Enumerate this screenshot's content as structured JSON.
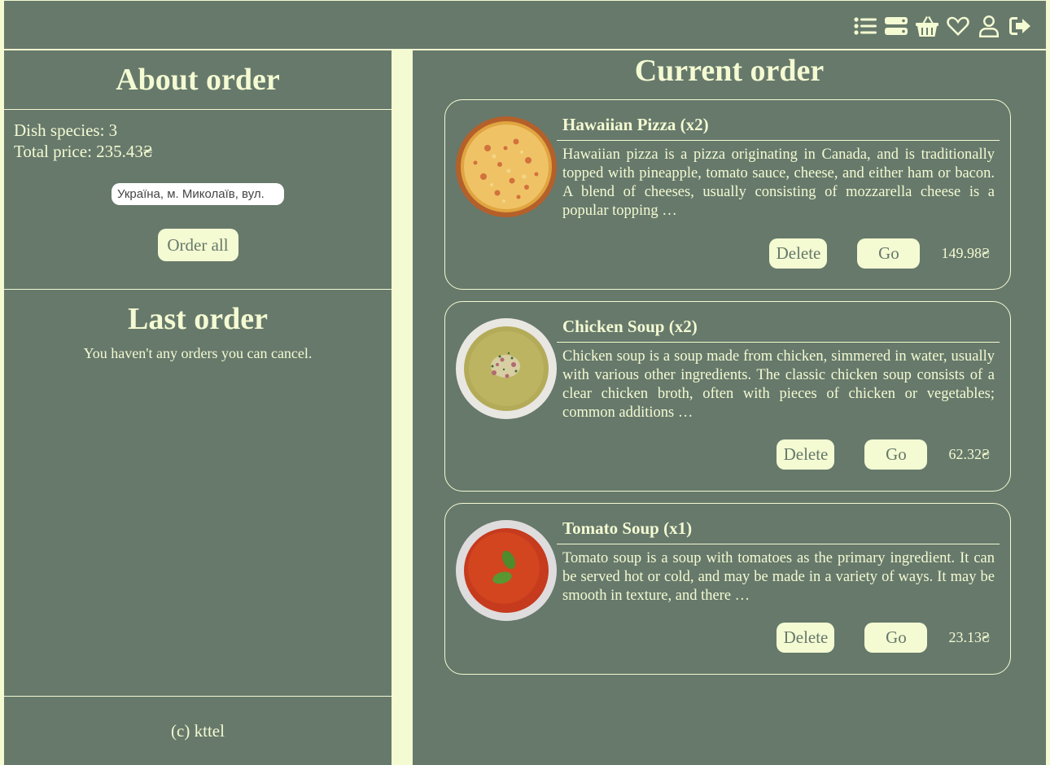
{
  "header": {
    "icons": [
      "list-icon",
      "menu-icon",
      "basket-icon",
      "heart-icon",
      "user-icon",
      "logout-icon"
    ]
  },
  "sidebar": {
    "about_title": "About order",
    "dish_species": "Dish species: 3",
    "total_price": "Total price: 235.43₴",
    "address_value": "Україна, м. Миколаїв, вул.",
    "order_all_label": "Order all",
    "last_order_title": "Last order",
    "last_order_message": "You haven't any orders you can cancel.",
    "footer": "(c) kttel"
  },
  "main": {
    "title": "Current order",
    "items": [
      {
        "title": "Hawaiian Pizza (x2)",
        "description": "Hawaiian pizza is a pizza originating in Canada, and is traditionally topped with pineapple, tomato sauce, cheese, and either ham or bacon. A blend of cheeses, usually consisting of mozzarella cheese is a popular topping …",
        "delete_label": "Delete",
        "go_label": "Go",
        "price": "149.98₴",
        "image": "hawaiian-pizza-photo"
      },
      {
        "title": "Chicken Soup (x2)",
        "description": "Chicken soup is a soup made from chicken, simmered in water, usually with various other ingredients. The classic chicken soup consists of a clear chicken broth, often with pieces of chicken or vegetables; common additions …",
        "delete_label": "Delete",
        "go_label": "Go",
        "price": "62.32₴",
        "image": "chicken-soup-photo"
      },
      {
        "title": "Tomato Soup (x1)",
        "description": "Tomato soup is a soup with tomatoes as the primary ingredient. It can be served hot or cold, and may be made in a variety of ways. It may be smooth in texture, and there …",
        "delete_label": "Delete",
        "go_label": "Go",
        "price": "23.13₴",
        "image": "tomato-soup-photo"
      }
    ]
  },
  "colors": {
    "panel": "#66796b",
    "accent": "#f4fad2"
  }
}
